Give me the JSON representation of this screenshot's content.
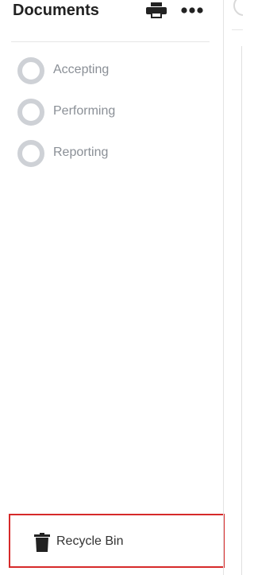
{
  "header": {
    "title": "Documents",
    "print_icon": "print-icon",
    "more_icon": "more-horizontal-icon"
  },
  "statuses": [
    {
      "label": "Accepting",
      "icon": "status-circle-icon"
    },
    {
      "label": "Performing",
      "icon": "status-circle-icon"
    },
    {
      "label": "Reporting",
      "icon": "status-circle-icon"
    }
  ],
  "recycle_bin": {
    "label": "Recycle Bin",
    "icon": "trash-icon"
  },
  "colors": {
    "highlight_border": "#d62a2a",
    "status_ring": "#ced1d6",
    "status_text": "#8a8f96",
    "title_text": "#222222"
  }
}
